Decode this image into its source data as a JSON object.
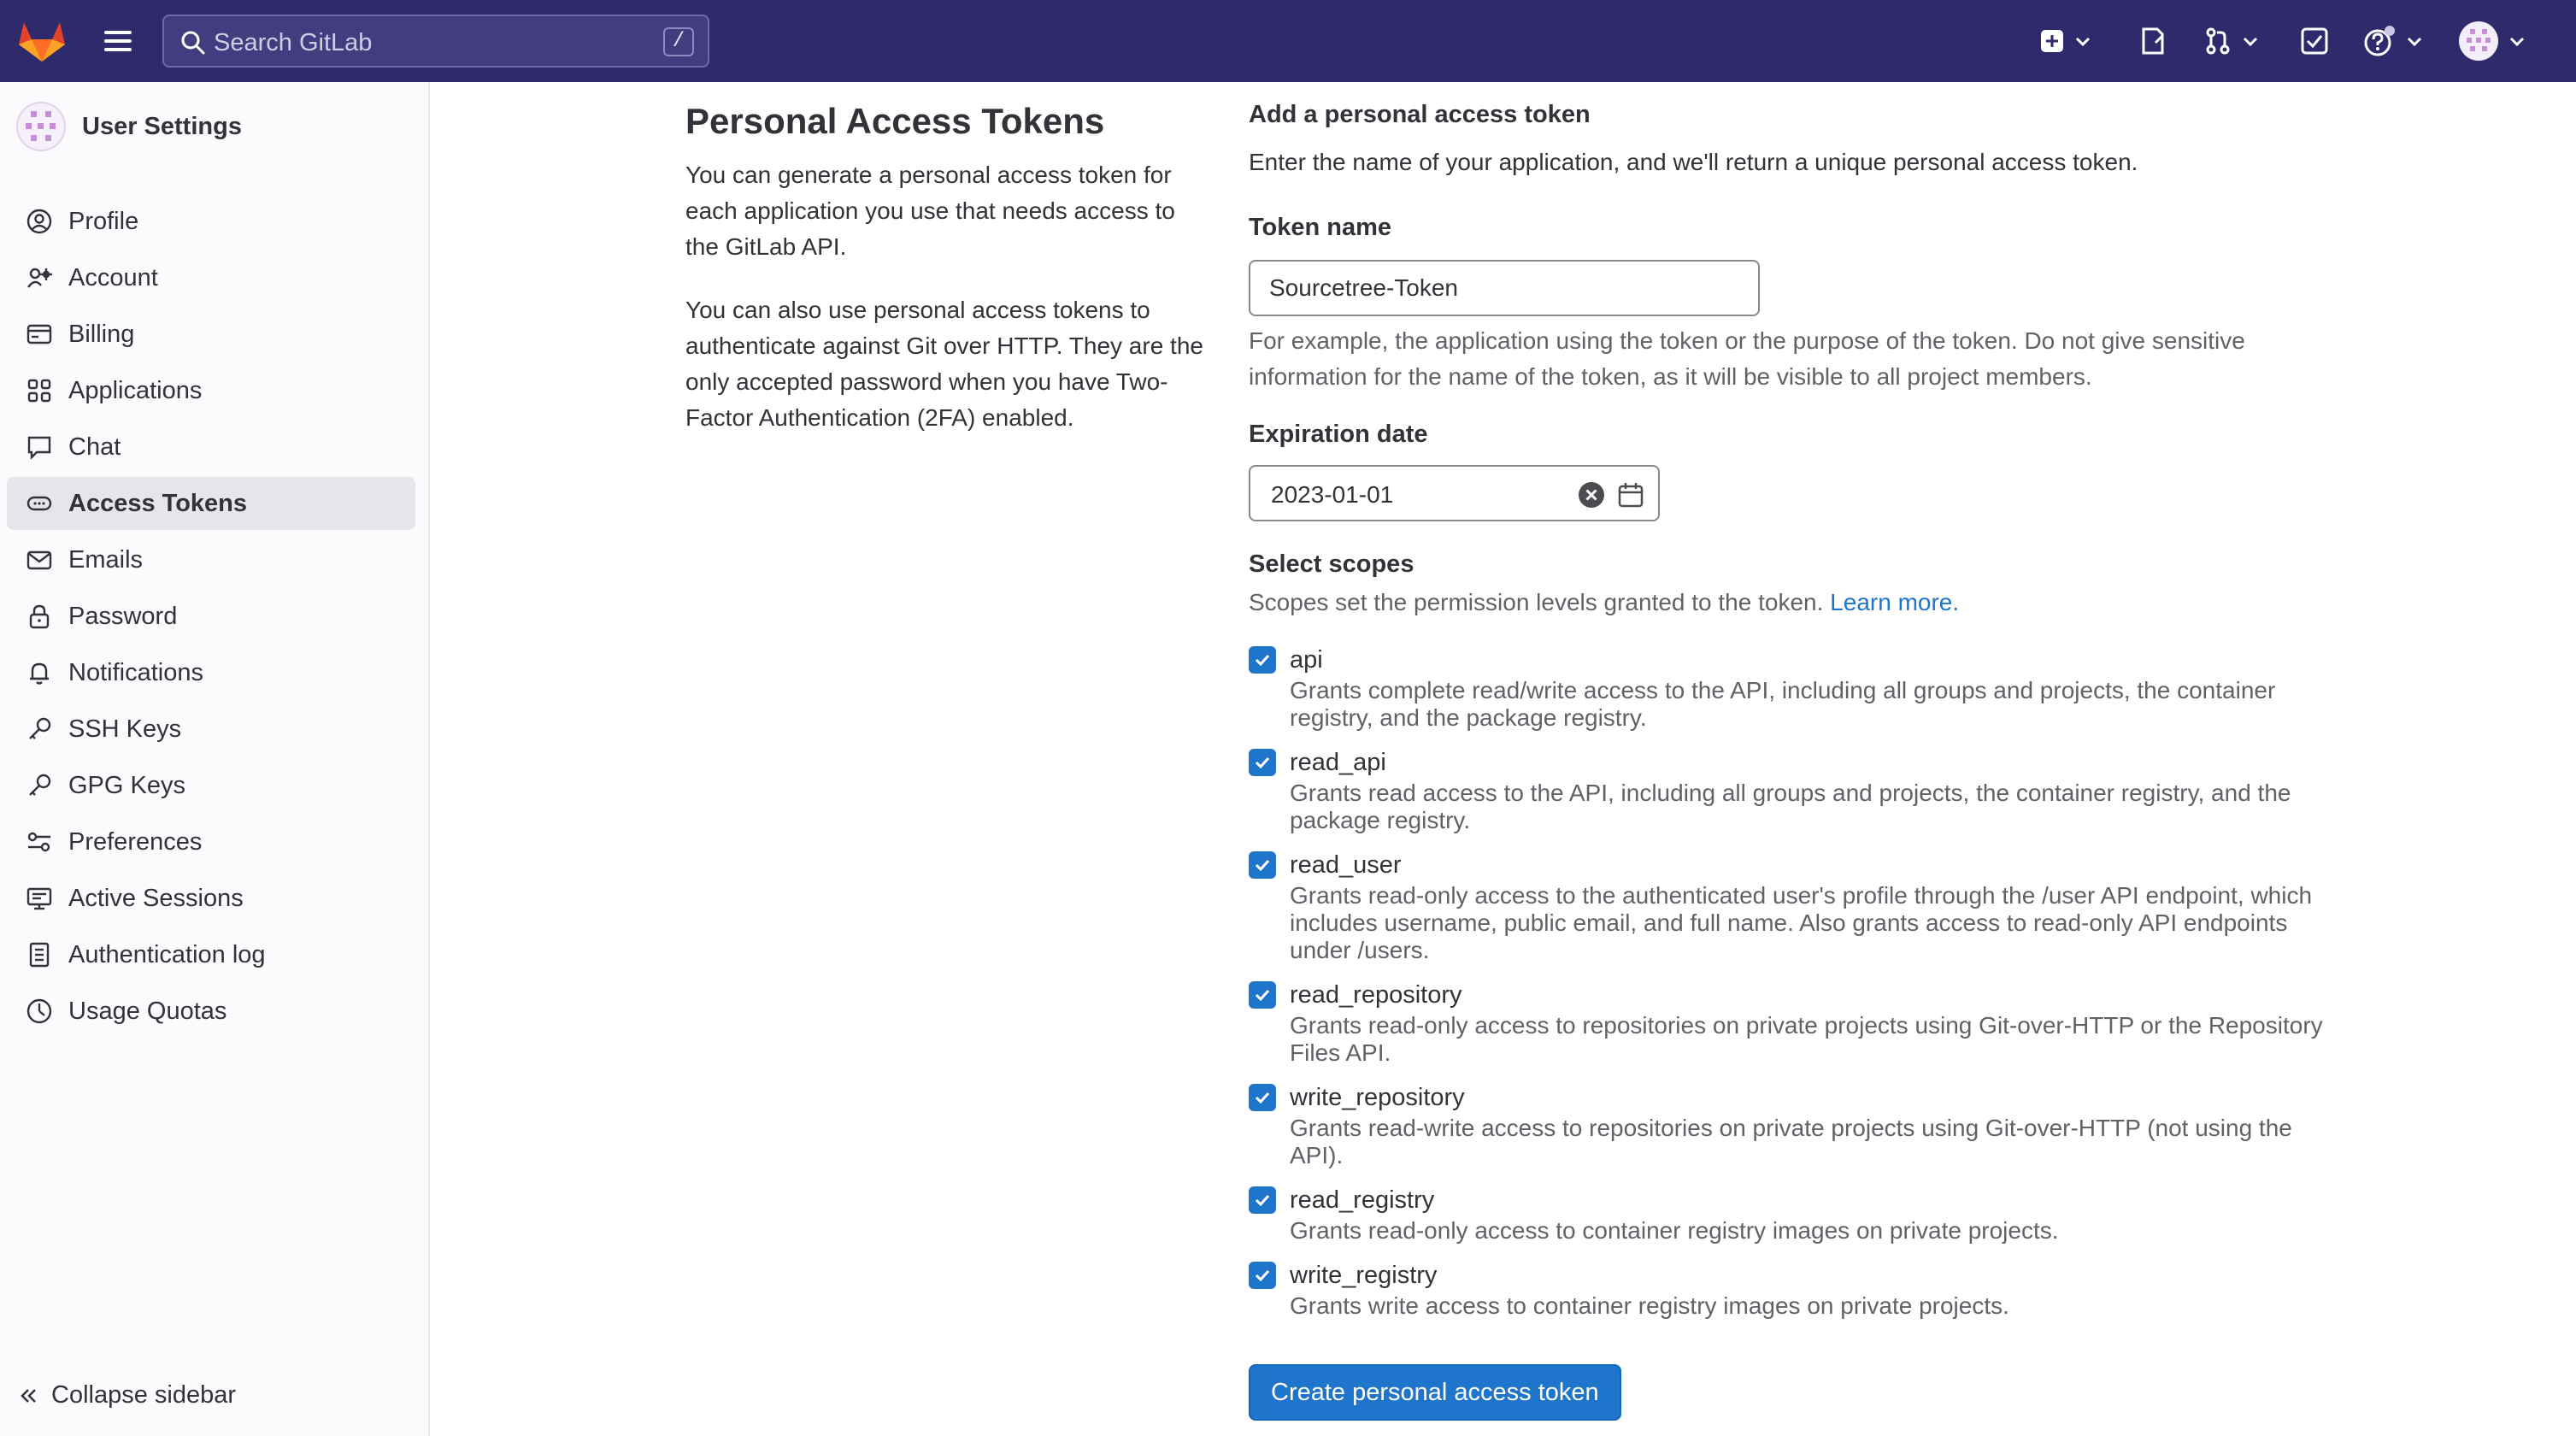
{
  "topbar": {
    "search_placeholder": "Search GitLab",
    "search_shortcut": "/"
  },
  "sidebar": {
    "title": "User Settings",
    "items": [
      {
        "label": "Profile",
        "icon": "profile-icon"
      },
      {
        "label": "Account",
        "icon": "account-icon"
      },
      {
        "label": "Billing",
        "icon": "billing-icon"
      },
      {
        "label": "Applications",
        "icon": "applications-icon"
      },
      {
        "label": "Chat",
        "icon": "chat-icon"
      },
      {
        "label": "Access Tokens",
        "icon": "token-icon",
        "active": true
      },
      {
        "label": "Emails",
        "icon": "mail-icon"
      },
      {
        "label": "Password",
        "icon": "lock-icon"
      },
      {
        "label": "Notifications",
        "icon": "bell-icon"
      },
      {
        "label": "SSH Keys",
        "icon": "key-icon"
      },
      {
        "label": "GPG Keys",
        "icon": "key-icon"
      },
      {
        "label": "Preferences",
        "icon": "preferences-icon"
      },
      {
        "label": "Active Sessions",
        "icon": "monitor-icon"
      },
      {
        "label": "Authentication log",
        "icon": "log-icon"
      },
      {
        "label": "Usage Quotas",
        "icon": "quota-icon"
      }
    ],
    "collapse_label": "Collapse sidebar"
  },
  "intro": {
    "title": "Personal Access Tokens",
    "paragraph1": "You can generate a personal access token for each application you use that needs access to the GitLab API.",
    "paragraph2": "You can also use personal access tokens to authenticate against Git over HTTP. They are the only accepted password when you have Two-Factor Authentication (2FA) enabled."
  },
  "form": {
    "heading": "Add a personal access token",
    "description": "Enter the name of your application, and we'll return a unique personal access token.",
    "token_name_label": "Token name",
    "token_name_value": "Sourcetree-Token",
    "token_name_help": "For example, the application using the token or the purpose of the token. Do not give sensitive information for the name of the token, as it will be visible to all project members.",
    "expiration_label": "Expiration date",
    "expiration_value": "2023-01-01",
    "scopes_label": "Select scopes",
    "scopes_help": "Scopes set the permission levels granted to the token.",
    "learn_more": "Learn more.",
    "submit_label": "Create personal access token"
  },
  "scopes": [
    {
      "name": "api",
      "checked": true,
      "description": "Grants complete read/write access to the API, including all groups and projects, the container registry, and the package registry."
    },
    {
      "name": "read_api",
      "checked": true,
      "description": "Grants read access to the API, including all groups and projects, the container registry, and the package registry."
    },
    {
      "name": "read_user",
      "checked": true,
      "description": "Grants read-only access to the authenticated user's profile through the /user API endpoint, which includes username, public email, and full name. Also grants access to read-only API endpoints under /users."
    },
    {
      "name": "read_repository",
      "checked": true,
      "description": "Grants read-only access to repositories on private projects using Git-over-HTTP or the Repository Files API."
    },
    {
      "name": "write_repository",
      "checked": true,
      "description": "Grants read-write access to repositories on private projects using Git-over-HTTP (not using the API)."
    },
    {
      "name": "read_registry",
      "checked": true,
      "description": "Grants read-only access to container registry images on private projects."
    },
    {
      "name": "write_registry",
      "checked": true,
      "description": "Grants write access to container registry images on private projects."
    }
  ],
  "colors": {
    "topbar": "#2f2a6b",
    "accent": "#1f75cb",
    "logo_orange": "#e24329"
  }
}
